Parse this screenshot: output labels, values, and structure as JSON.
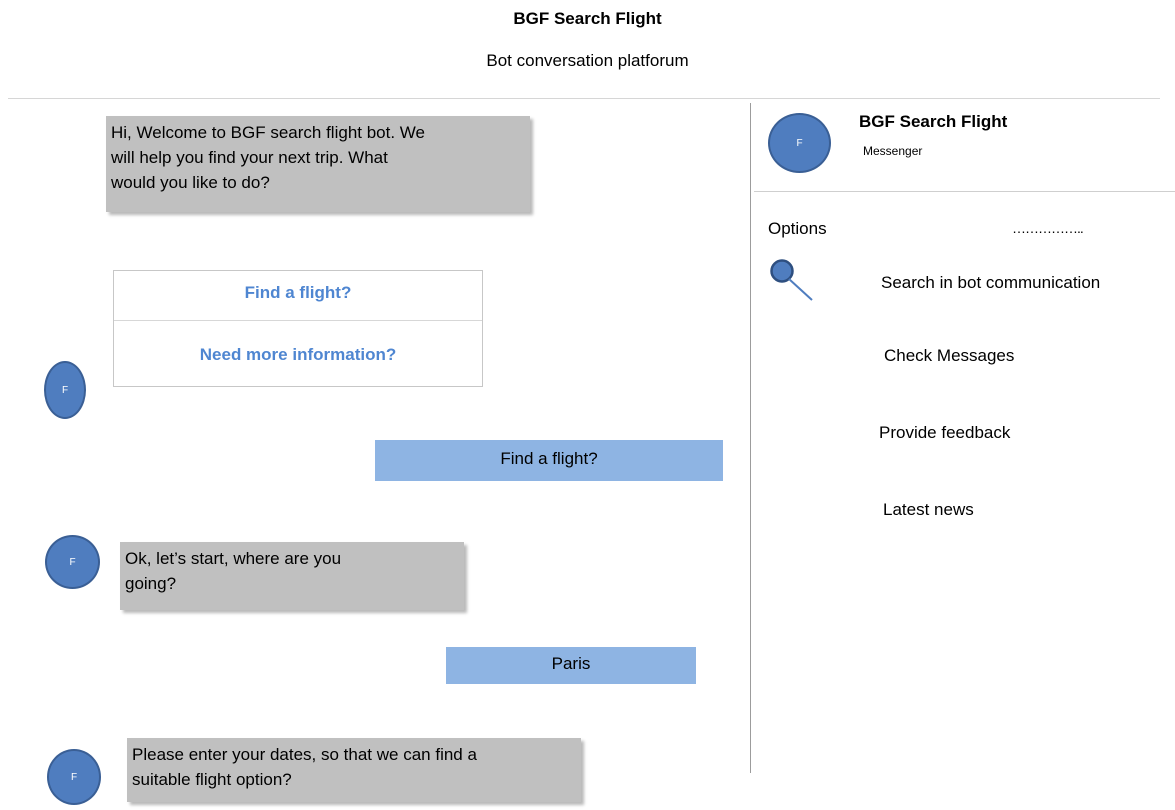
{
  "header": {
    "title": "BGF Search Flight",
    "subtitle": "Bot conversation platforum"
  },
  "avatar": {
    "initial": "F",
    "color": "#4f7dbf"
  },
  "messages": [
    {
      "sender": "bot",
      "lines": [
        "Hi, Welcome to BGF search flight bot. We",
        "will help you find your next trip. What",
        "would you like to do?"
      ]
    },
    {
      "sender": "bot",
      "type": "quick-replies",
      "options": [
        "Find a flight?",
        "Need more information?"
      ]
    },
    {
      "sender": "user",
      "text": "Find a flight?"
    },
    {
      "sender": "bot",
      "lines": [
        "Ok, let’s start, where are you",
        "going?"
      ]
    },
    {
      "sender": "user",
      "text": "Paris"
    },
    {
      "sender": "bot",
      "lines": [
        "Please enter your dates, so that we can find a",
        "suitable flight option?"
      ]
    }
  ],
  "sidebar": {
    "profile": {
      "name": "BGF Search Flight",
      "subtitle": "Messenger"
    },
    "options_label": "Options",
    "options_dots": "……………..",
    "items": [
      {
        "label": "Search in bot communication",
        "icon": "search-icon"
      },
      {
        "label": "Check Messages"
      },
      {
        "label": "Provide feedback"
      },
      {
        "label": "Latest news"
      }
    ]
  },
  "colors": {
    "bot_bubble": "#c0c0c0",
    "user_bubble": "#8eb4e3",
    "quick_reply_text": "#4f86d1",
    "avatar": "#4f7dbf"
  }
}
